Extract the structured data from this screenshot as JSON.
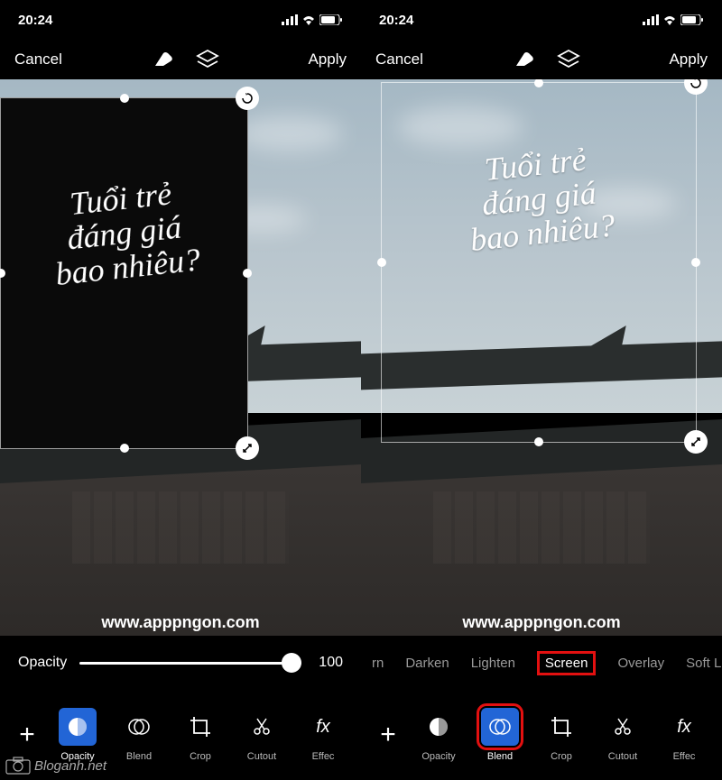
{
  "status": {
    "time": "20:24"
  },
  "topbar": {
    "cancel": "Cancel",
    "apply": "Apply"
  },
  "overlay_text": {
    "line1": "Tuổi trẻ",
    "line2": "đáng giá",
    "line3": "bao nhiêu?"
  },
  "watermark": "www.apppngon.com",
  "slider": {
    "label": "Opacity",
    "value": "100"
  },
  "blend_modes": {
    "m0": "rn",
    "m1": "Darken",
    "m2": "Lighten",
    "m3": "Screen",
    "m4": "Overlay",
    "m5": "Soft Light"
  },
  "tools": {
    "opacity": "Opacity",
    "blend": "Blend",
    "crop": "Crop",
    "cutout": "Cutout",
    "effect": "Effec"
  },
  "plus": "+",
  "fx_label": "fx",
  "blog_logo": "Bloganh.net"
}
